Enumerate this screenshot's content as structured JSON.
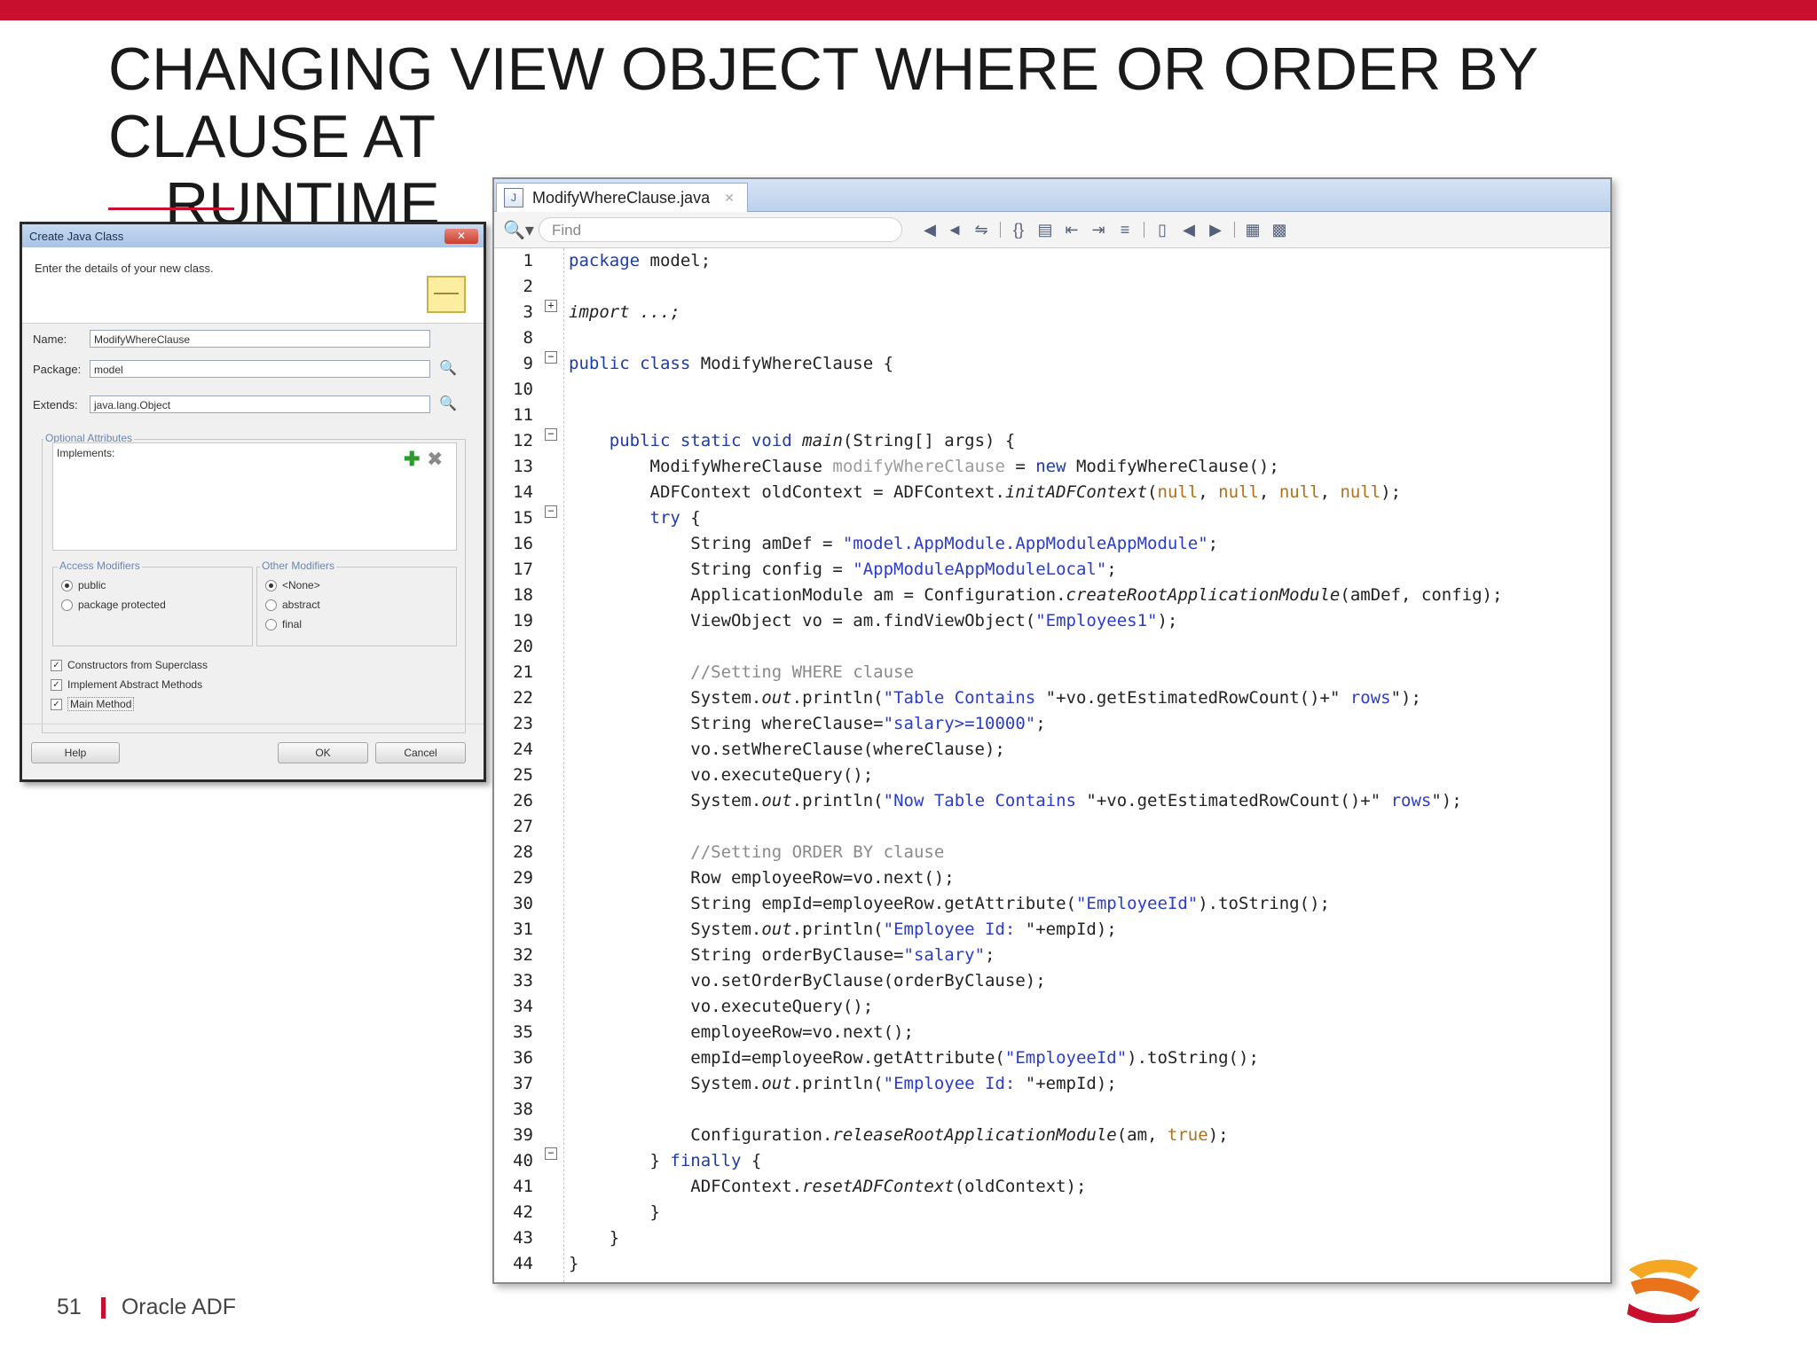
{
  "slide": {
    "title_line1": "CHANGING VIEW OBJECT WHERE OR ORDER BY CLAUSE AT",
    "title_line2": "RUNTIME",
    "page_number": "51",
    "footer_text": "Oracle ADF",
    "accent_color": "#c8102e"
  },
  "dialog": {
    "title": "Create Java Class",
    "description": "Enter the details of your new class.",
    "name_label": "Name:",
    "name_value": "ModifyWhereClause",
    "package_label": "Package:",
    "package_value": "model",
    "extends_label": "Extends:",
    "extends_value": "java.lang.Object",
    "optional_attributes": "Optional Attributes",
    "implements_label": "Implements:",
    "access_modifiers": "Access Modifiers",
    "public_label": "public",
    "package_protected_label": "package protected",
    "other_modifiers": "Other Modifiers",
    "none_label": "<None>",
    "abstract_label": "abstract",
    "final_label": "final",
    "constructors_label": "Constructors from Superclass",
    "implement_abstract_label": "Implement Abstract Methods",
    "main_method_label": "Main Method",
    "help_button": "Help",
    "ok_button": "OK",
    "cancel_button": "Cancel"
  },
  "editor": {
    "tab_label": "ModifyWhereClause.java",
    "find_placeholder": "Find",
    "line_numbers": [
      "1",
      "2",
      "3",
      "8",
      "9",
      "10",
      "11",
      "12",
      "13",
      "14",
      "15",
      "16",
      "17",
      "18",
      "19",
      "20",
      "21",
      "22",
      "23",
      "24",
      "25",
      "26",
      "27",
      "28",
      "29",
      "30",
      "31",
      "32",
      "33",
      "34",
      "35",
      "36",
      "37",
      "38",
      "39",
      "40",
      "41",
      "42",
      "43",
      "44"
    ]
  }
}
